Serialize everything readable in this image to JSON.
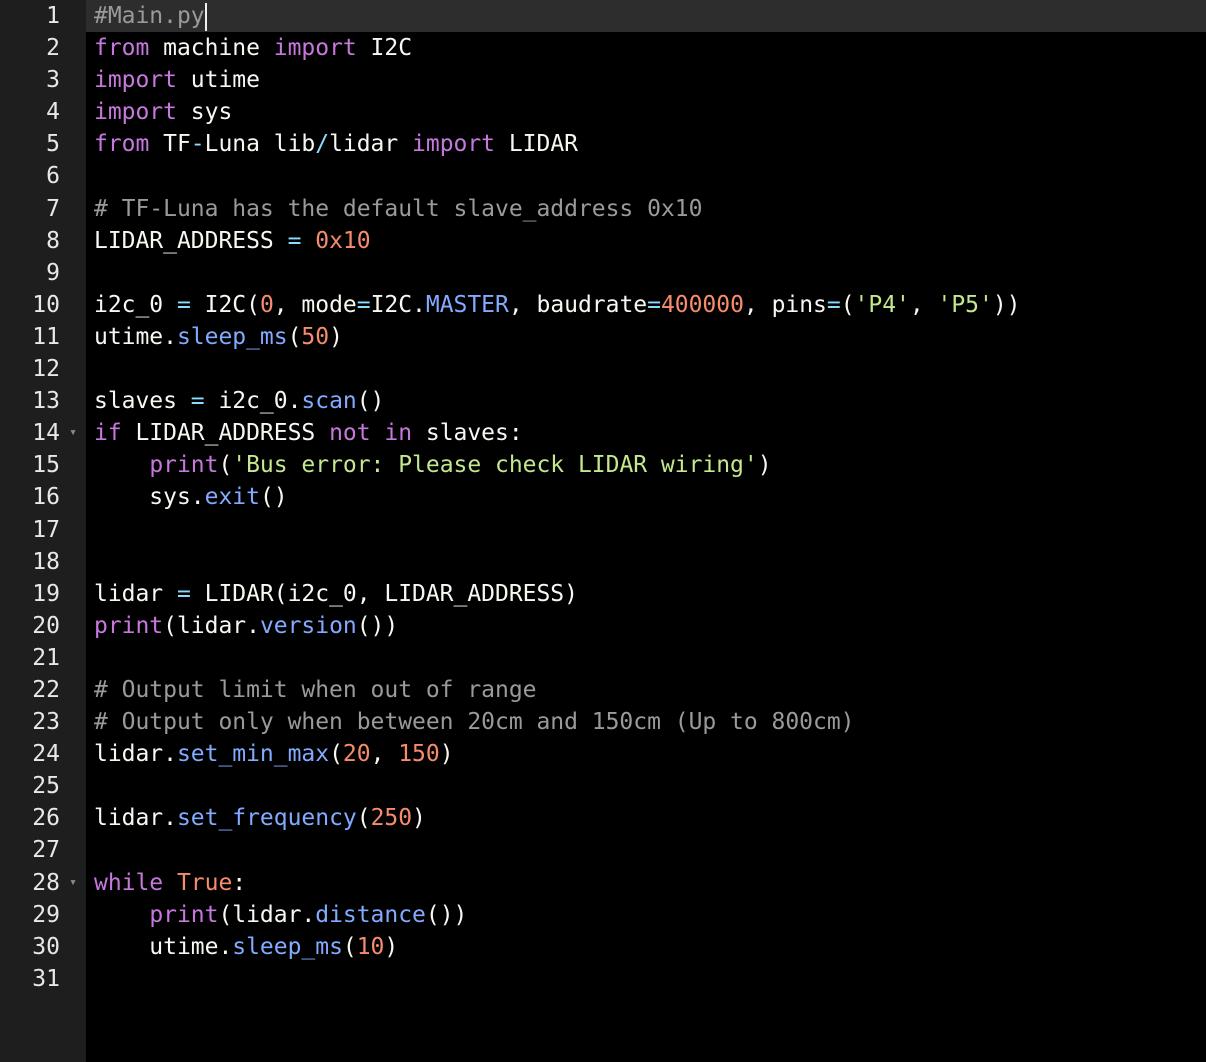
{
  "editor": {
    "active_line": 1,
    "colors": {
      "background": "#000000",
      "gutter": "#1e1e1e",
      "active_line": "#2d2d2d",
      "keyword": "#c678dd",
      "string": "#c3e88d",
      "number": "#f78c6c",
      "comment": "#9a9a9a",
      "method": "#82aaff",
      "operator": "#89ddff"
    },
    "lines": [
      {
        "n": "1",
        "fold": false,
        "tokens": [
          {
            "t": "#Main.py",
            "c": "cmt"
          }
        ],
        "cursor": true
      },
      {
        "n": "2",
        "fold": false,
        "tokens": [
          {
            "t": "from",
            "c": "kw"
          },
          {
            "t": " machine ",
            "c": "pl"
          },
          {
            "t": "import",
            "c": "kw"
          },
          {
            "t": " I2C",
            "c": "pl"
          }
        ]
      },
      {
        "n": "3",
        "fold": false,
        "tokens": [
          {
            "t": "import",
            "c": "kw"
          },
          {
            "t": " utime",
            "c": "pl"
          }
        ]
      },
      {
        "n": "4",
        "fold": false,
        "tokens": [
          {
            "t": "import",
            "c": "kw"
          },
          {
            "t": " sys",
            "c": "pl"
          }
        ]
      },
      {
        "n": "5",
        "fold": false,
        "tokens": [
          {
            "t": "from",
            "c": "kw"
          },
          {
            "t": " TF",
            "c": "pl"
          },
          {
            "t": "-",
            "c": "op"
          },
          {
            "t": "Luna lib",
            "c": "pl"
          },
          {
            "t": "/",
            "c": "op"
          },
          {
            "t": "lidar ",
            "c": "pl"
          },
          {
            "t": "import",
            "c": "kw"
          },
          {
            "t": " LIDAR",
            "c": "pl"
          }
        ]
      },
      {
        "n": "6",
        "fold": false,
        "tokens": []
      },
      {
        "n": "7",
        "fold": false,
        "tokens": [
          {
            "t": "# TF-Luna has the default slave_address 0x10",
            "c": "cmt"
          }
        ]
      },
      {
        "n": "8",
        "fold": false,
        "tokens": [
          {
            "t": "LIDAR_ADDRESS ",
            "c": "pl"
          },
          {
            "t": "=",
            "c": "op"
          },
          {
            "t": " ",
            "c": "pl"
          },
          {
            "t": "0x10",
            "c": "num"
          }
        ]
      },
      {
        "n": "9",
        "fold": false,
        "tokens": []
      },
      {
        "n": "10",
        "fold": false,
        "tokens": [
          {
            "t": "i2c_0 ",
            "c": "pl"
          },
          {
            "t": "=",
            "c": "op"
          },
          {
            "t": " I2C(",
            "c": "pl"
          },
          {
            "t": "0",
            "c": "num"
          },
          {
            "t": ", mode",
            "c": "pl"
          },
          {
            "t": "=",
            "c": "op"
          },
          {
            "t": "I2C.",
            "c": "pl"
          },
          {
            "t": "MASTER",
            "c": "mth"
          },
          {
            "t": ", baudrate",
            "c": "pl"
          },
          {
            "t": "=",
            "c": "op"
          },
          {
            "t": "400000",
            "c": "num"
          },
          {
            "t": ", pins",
            "c": "pl"
          },
          {
            "t": "=",
            "c": "op"
          },
          {
            "t": "(",
            "c": "pl"
          },
          {
            "t": "'P4'",
            "c": "str"
          },
          {
            "t": ", ",
            "c": "pl"
          },
          {
            "t": "'P5'",
            "c": "str"
          },
          {
            "t": "))",
            "c": "pl"
          }
        ]
      },
      {
        "n": "11",
        "fold": false,
        "tokens": [
          {
            "t": "utime.",
            "c": "pl"
          },
          {
            "t": "sleep_ms",
            "c": "mth"
          },
          {
            "t": "(",
            "c": "pl"
          },
          {
            "t": "50",
            "c": "num"
          },
          {
            "t": ")",
            "c": "pl"
          }
        ]
      },
      {
        "n": "12",
        "fold": false,
        "tokens": []
      },
      {
        "n": "13",
        "fold": false,
        "tokens": [
          {
            "t": "slaves ",
            "c": "pl"
          },
          {
            "t": "=",
            "c": "op"
          },
          {
            "t": " i2c_0.",
            "c": "pl"
          },
          {
            "t": "scan",
            "c": "mth"
          },
          {
            "t": "()",
            "c": "pl"
          }
        ]
      },
      {
        "n": "14",
        "fold": true,
        "tokens": [
          {
            "t": "if",
            "c": "kw"
          },
          {
            "t": " LIDAR_ADDRESS ",
            "c": "pl"
          },
          {
            "t": "not",
            "c": "kw"
          },
          {
            "t": " ",
            "c": "pl"
          },
          {
            "t": "in",
            "c": "kw"
          },
          {
            "t": " slaves:",
            "c": "pl"
          }
        ]
      },
      {
        "n": "15",
        "fold": false,
        "tokens": [
          {
            "t": "    ",
            "c": "pl"
          },
          {
            "t": "print",
            "c": "fn"
          },
          {
            "t": "(",
            "c": "pl"
          },
          {
            "t": "'Bus error: Please check LIDAR wiring'",
            "c": "str"
          },
          {
            "t": ")",
            "c": "pl"
          }
        ]
      },
      {
        "n": "16",
        "fold": false,
        "tokens": [
          {
            "t": "    sys.",
            "c": "pl"
          },
          {
            "t": "exit",
            "c": "mth"
          },
          {
            "t": "()",
            "c": "pl"
          }
        ]
      },
      {
        "n": "17",
        "fold": false,
        "tokens": []
      },
      {
        "n": "18",
        "fold": false,
        "tokens": []
      },
      {
        "n": "19",
        "fold": false,
        "tokens": [
          {
            "t": "lidar ",
            "c": "pl"
          },
          {
            "t": "=",
            "c": "op"
          },
          {
            "t": " LIDAR(i2c_0, LIDAR_ADDRESS)",
            "c": "pl"
          }
        ]
      },
      {
        "n": "20",
        "fold": false,
        "tokens": [
          {
            "t": "print",
            "c": "fn"
          },
          {
            "t": "(lidar.",
            "c": "pl"
          },
          {
            "t": "version",
            "c": "mth"
          },
          {
            "t": "())",
            "c": "pl"
          }
        ]
      },
      {
        "n": "21",
        "fold": false,
        "tokens": []
      },
      {
        "n": "22",
        "fold": false,
        "tokens": [
          {
            "t": "# Output limit when out of range",
            "c": "cmt"
          }
        ]
      },
      {
        "n": "23",
        "fold": false,
        "tokens": [
          {
            "t": "# Output only when between 20cm and 150cm (Up to 800cm)",
            "c": "cmt"
          }
        ]
      },
      {
        "n": "24",
        "fold": false,
        "tokens": [
          {
            "t": "lidar.",
            "c": "pl"
          },
          {
            "t": "set_min_max",
            "c": "mth"
          },
          {
            "t": "(",
            "c": "pl"
          },
          {
            "t": "20",
            "c": "num"
          },
          {
            "t": ", ",
            "c": "pl"
          },
          {
            "t": "150",
            "c": "num"
          },
          {
            "t": ")",
            "c": "pl"
          }
        ]
      },
      {
        "n": "25",
        "fold": false,
        "tokens": []
      },
      {
        "n": "26",
        "fold": false,
        "tokens": [
          {
            "t": "lidar.",
            "c": "pl"
          },
          {
            "t": "set_frequency",
            "c": "mth"
          },
          {
            "t": "(",
            "c": "pl"
          },
          {
            "t": "250",
            "c": "num"
          },
          {
            "t": ")",
            "c": "pl"
          }
        ]
      },
      {
        "n": "27",
        "fold": false,
        "tokens": []
      },
      {
        "n": "28",
        "fold": true,
        "tokens": [
          {
            "t": "while",
            "c": "kw"
          },
          {
            "t": " ",
            "c": "pl"
          },
          {
            "t": "True",
            "c": "con"
          },
          {
            "t": ":",
            "c": "pl"
          }
        ]
      },
      {
        "n": "29",
        "fold": false,
        "tokens": [
          {
            "t": "    ",
            "c": "pl"
          },
          {
            "t": "print",
            "c": "fn"
          },
          {
            "t": "(lidar.",
            "c": "pl"
          },
          {
            "t": "distance",
            "c": "mth"
          },
          {
            "t": "())",
            "c": "pl"
          }
        ]
      },
      {
        "n": "30",
        "fold": false,
        "tokens": [
          {
            "t": "    utime.",
            "c": "pl"
          },
          {
            "t": "sleep_ms",
            "c": "mth"
          },
          {
            "t": "(",
            "c": "pl"
          },
          {
            "t": "10",
            "c": "num"
          },
          {
            "t": ")",
            "c": "pl"
          }
        ]
      },
      {
        "n": "31",
        "fold": false,
        "tokens": []
      }
    ]
  }
}
